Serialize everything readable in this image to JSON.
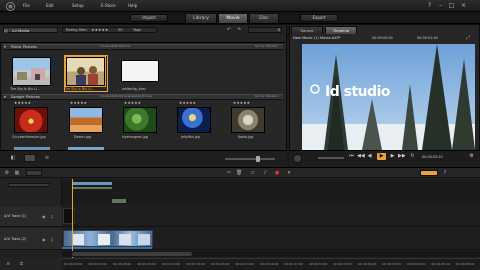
{
  "menubar": {
    "items": [
      "File",
      "Edit",
      "Setup",
      "E-Store",
      "Help"
    ]
  },
  "subbar": {
    "import_label": "Import",
    "export_label": "Export",
    "tabs": [
      "Library",
      "Movie",
      "Disc"
    ],
    "active_tab": "Movie"
  },
  "library": {
    "collection_label": "All Media",
    "rating_label": "Rating filter",
    "count_label": "50",
    "tags_label": "Tags",
    "sections": [
      {
        "title": "Public Pictures",
        "path": "C:\\Users\\Public\\Pictures",
        "info": "Sort by: Filename",
        "items": [
          {
            "caption": "The Sky Is Blu Li...",
            "kind": "photo"
          },
          {
            "caption": "The Sky Is Blu Li...",
            "kind": "photo",
            "selected": true
          },
          {
            "caption": "whiteclip_4sec",
            "kind": "white"
          }
        ]
      },
      {
        "title": "Sample Pictures",
        "path": "C:\\Users\\Public\\Pictures\\Sample Pictures",
        "info": "Sort by: Filename",
        "items": [
          {
            "caption": "Chrysanthemum.jpg",
            "kind": "red"
          },
          {
            "caption": "Desert.jpg",
            "kind": "desert"
          },
          {
            "caption": "Hydrangeas.jpg",
            "kind": "green"
          },
          {
            "caption": "Jellyfish.jpg",
            "kind": "blue"
          },
          {
            "caption": "Koala.jpg",
            "kind": "koala"
          }
        ]
      }
    ]
  },
  "preview": {
    "tabs": [
      "Source",
      "Timeline"
    ],
    "title": "New Movie (1) Movie.AXP*",
    "timecode_left": "00:00:00:00",
    "timecode_right": "00:00:01:30",
    "overlay_text": "Id studio",
    "bottom_timecode": "00:00:05:20"
  },
  "timeline": {
    "tracks": [
      {
        "label": "A/V Track (1)"
      },
      {
        "label": "A/V Track (2)"
      }
    ],
    "ruler_ticks": [
      "00:00:00:00",
      "00:00:03:00",
      "00:00:06:00",
      "00:00:09:00",
      "00:00:12:00",
      "00:00:15:00",
      "00:00:18:00",
      "00:00:21:00",
      "00:00:24:00",
      "00:00:27:00",
      "00:00:30:00",
      "00:00:33:00",
      "00:00:36:00",
      "00:00:39:00",
      "00:00:42:00",
      "00:00:45:00",
      "00:00:48:00"
    ]
  },
  "colors": {
    "accent": "#e8a23c",
    "selection": "#e8a23c"
  }
}
